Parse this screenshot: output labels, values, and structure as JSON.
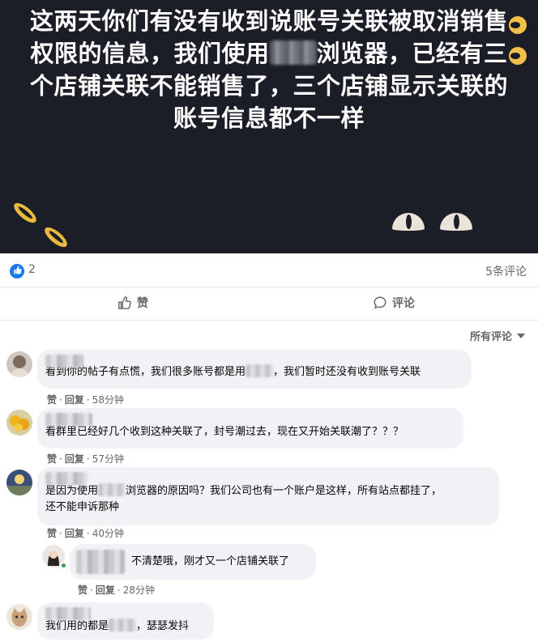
{
  "post": {
    "line1": "这两天你们有没有收到说账号关联被取消销售",
    "line2a": "权限的信息，我们使用",
    "line2b": "浏览器，已经有三",
    "line3": "个店铺关联不能销售了，三个店铺显示关联的",
    "line4": "账号信息都不一样"
  },
  "reactions": {
    "like_count": "2",
    "comment_count": "5条评论"
  },
  "actions": {
    "like": "赞",
    "comment": "评论"
  },
  "sort_label": "所有评论",
  "comments": [
    {
      "text_a": "看到你的帖子有点慌，我们很多账号都是用",
      "text_b": "，我们暂时还没有收到账号关联",
      "like": "赞",
      "reply": "回复",
      "time": "58分钟"
    },
    {
      "text": "看群里已经好几个收到这种关联了，封号潮过去，现在又开始关联潮了？？？",
      "like": "赞",
      "reply": "回复",
      "time": "57分钟"
    },
    {
      "text_a": "是因为使用",
      "text_b": "浏览器的原因吗？我们公司也有一个账户是这样，所有站点都挂了，",
      "text_c": "还不能申诉那种",
      "like": "赞",
      "reply": "回复",
      "time": "40分钟"
    },
    {
      "text": "不清楚哦，刚才又一个店铺关联了",
      "like": "赞",
      "reply": "回复",
      "time": "28分钟"
    },
    {
      "text_a": "我们用的都是",
      "text_b": "，瑟瑟发抖"
    }
  ],
  "colors": {
    "post_bg": "#1b1d27",
    "accent_blue": "#1877f2",
    "bubble_bg": "#f0f2f5",
    "meta_gray": "#65676b"
  }
}
